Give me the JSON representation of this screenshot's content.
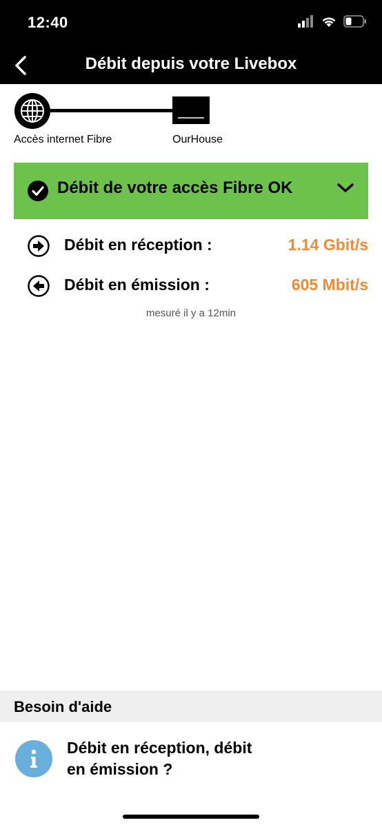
{
  "status_bar": {
    "time": "12:40"
  },
  "nav": {
    "title": "Débit depuis votre Livebox",
    "back_icon": "chevron-left-icon"
  },
  "connection": {
    "source_label": "Accès internet Fibre",
    "device_label": "OurHouse"
  },
  "banner": {
    "text": "Débit de votre accès Fibre OK",
    "color": "#6cc24a"
  },
  "rates": [
    {
      "label": "Débit en réception :",
      "value": "1.14 Gbit/s",
      "icon": "arrow-right-circle-icon"
    },
    {
      "label": "Débit en émission :",
      "value": "605 Mbit/s",
      "icon": "arrow-left-circle-icon"
    }
  ],
  "measured": "mesuré il y a 12min",
  "accent_color": "#f08a35",
  "help": {
    "header": "Besoin d'aide",
    "item_line1": "Débit en réception, débit",
    "item_line2": "en émission ?"
  }
}
